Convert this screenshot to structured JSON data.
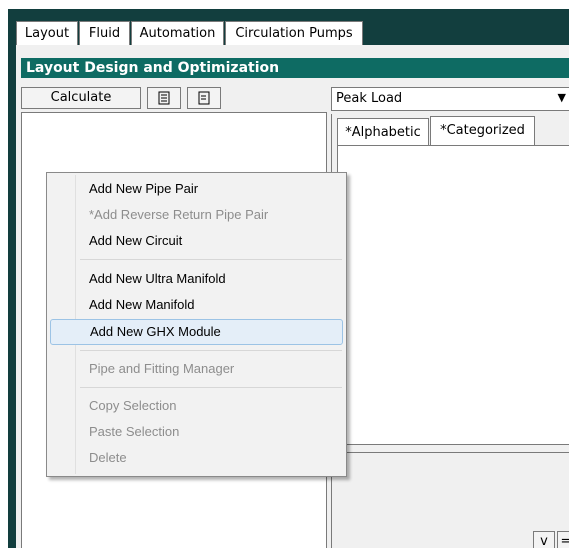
{
  "tabs": [
    "Layout",
    "Fluid",
    "Automation",
    "Circulation Pumps"
  ],
  "panel": {
    "title": "Layout Design and Optimization"
  },
  "toolbar": {
    "calculate_label": "Calculate"
  },
  "right": {
    "dropdown_value": "Peak Load",
    "subtabs": [
      "*Alphabetic",
      "*Categorized"
    ],
    "small_buttons": [
      "v",
      "="
    ]
  },
  "context_menu": {
    "items": [
      {
        "label": "Add New Pipe Pair",
        "enabled": true
      },
      {
        "label": "*Add Reverse Return Pipe Pair",
        "enabled": false
      },
      {
        "label": "Add New Circuit",
        "enabled": true
      },
      {
        "label": "Add New Ultra Manifold",
        "enabled": true
      },
      {
        "label": "Add New Manifold",
        "enabled": true
      },
      {
        "label": "Add New GHX Module",
        "enabled": true,
        "highlighted": true
      },
      {
        "label": "Pipe and Fitting Manager",
        "enabled": false
      },
      {
        "label": "Copy Selection",
        "enabled": false
      },
      {
        "label": "Paste Selection",
        "enabled": false
      },
      {
        "label": "Delete",
        "enabled": false
      }
    ]
  },
  "colors": {
    "frame": "#123e3e",
    "title_bar": "#0e6b63",
    "menu_highlight": "#e4eef8"
  }
}
